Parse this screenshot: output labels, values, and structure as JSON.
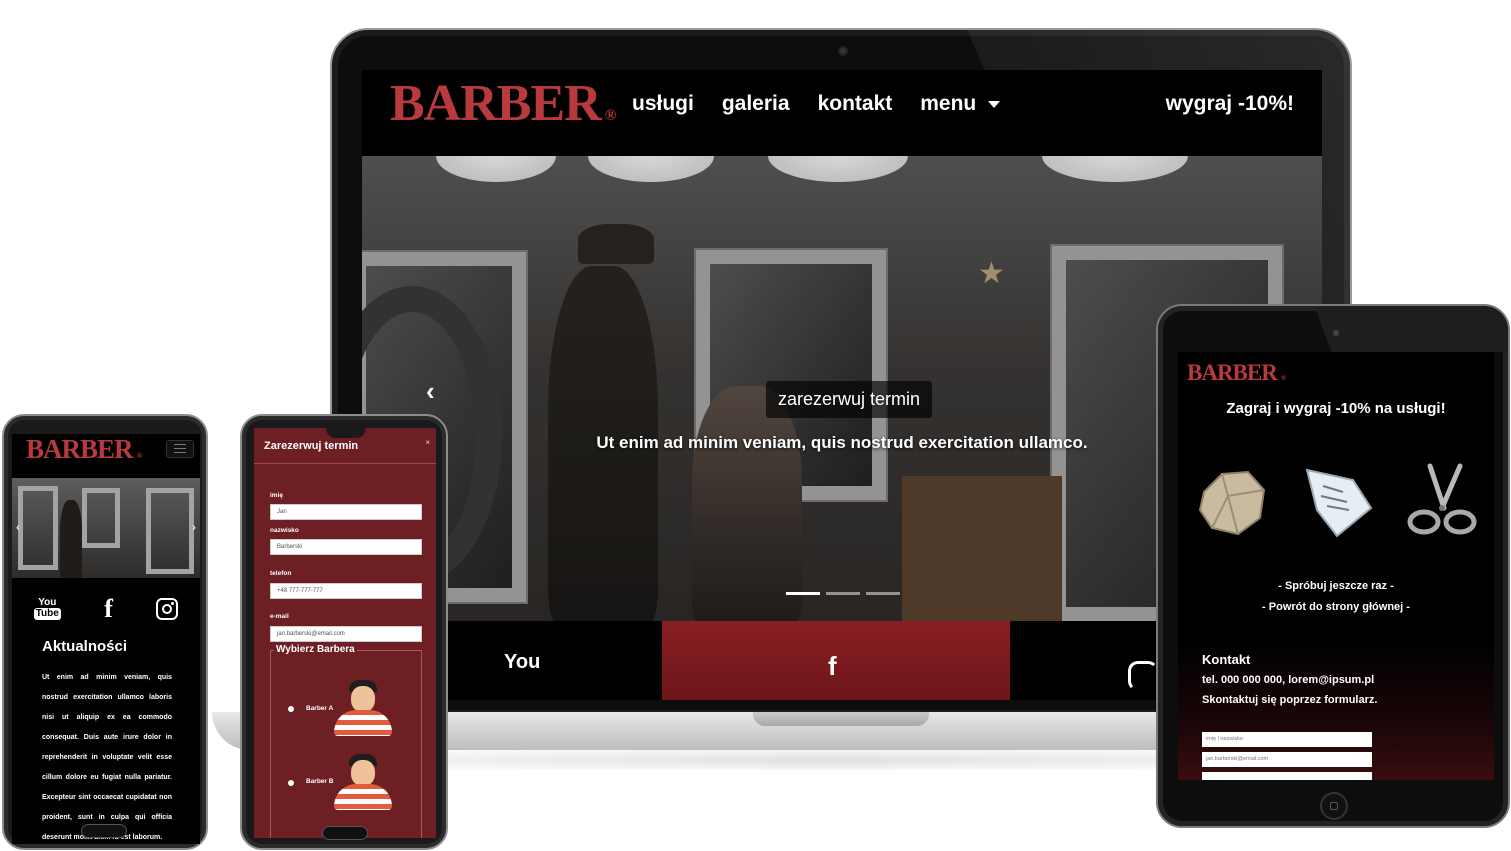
{
  "laptop": {
    "brand": "BARBER",
    "brand_mark": "®",
    "nav": [
      "usługi",
      "galeria",
      "kontakt",
      "menu"
    ],
    "promo": "wygraj -10%!",
    "hero": {
      "cta": "zarezerwuj termin",
      "subtitle": "Ut enim ad minim veniam, quis nostrud exercitation ullamco.",
      "prev_arrow": "‹",
      "slides": 3,
      "active_slide": 1
    },
    "bottom": {
      "youtube_partial": "You",
      "facebook_partial": "f"
    }
  },
  "phone_news": {
    "brand": "BARBER",
    "brand_mark": "®",
    "social": {
      "youtube_top": "You",
      "youtube_bottom": "Tube",
      "facebook": "f"
    },
    "title": "Aktualności",
    "text": "Ut enim ad minim veniam, quis nostrud exercitation ullamco laboris nisi ut aliquip ex ea commodo consequat. Duis aute irure dolor in reprehenderit in voluptate velit esse cillum dolore eu fugiat nulla pariatur. Excepteur sint occaecat cupidatat non proident, sunt in culpa qui officia deserunt mollit anim id est laborum."
  },
  "phone_booking": {
    "title": "Zarezerwuj termin",
    "close": "×",
    "fields": [
      {
        "label": "imię",
        "value": "Jan"
      },
      {
        "label": "nazwisko",
        "value": "Barberski"
      },
      {
        "label": "telefon",
        "value": "+48 777-777-777"
      },
      {
        "label": "e-mail",
        "value": "jan.barberski@email.com"
      }
    ],
    "legend": "Wybierz Barbera",
    "barbers": [
      "Barber A",
      "Barber B"
    ]
  },
  "tablet": {
    "brand": "BARBER",
    "brand_mark": "®",
    "heading": "Zagraj i wygraj -10% na usługi!",
    "icons": [
      "rock-icon",
      "paper-icon",
      "scissors-icon"
    ],
    "try_again": "- Spróbuj jeszcze raz -",
    "go_home": "- Powrót do strony głównej -",
    "contact": {
      "title": "Kontakt",
      "phone_line": "tel. 000 000 000, lorem@ipsum.pl",
      "form_line": "Skontaktuj się poprzez formularz.",
      "name_placeholder": "imię i nazwisko",
      "email_value": "jan.barberski@email.com"
    }
  },
  "colors": {
    "brand_red": "#b83a3f",
    "booking_bg": "#6d1f23",
    "cta_red": "#8a1f24"
  }
}
